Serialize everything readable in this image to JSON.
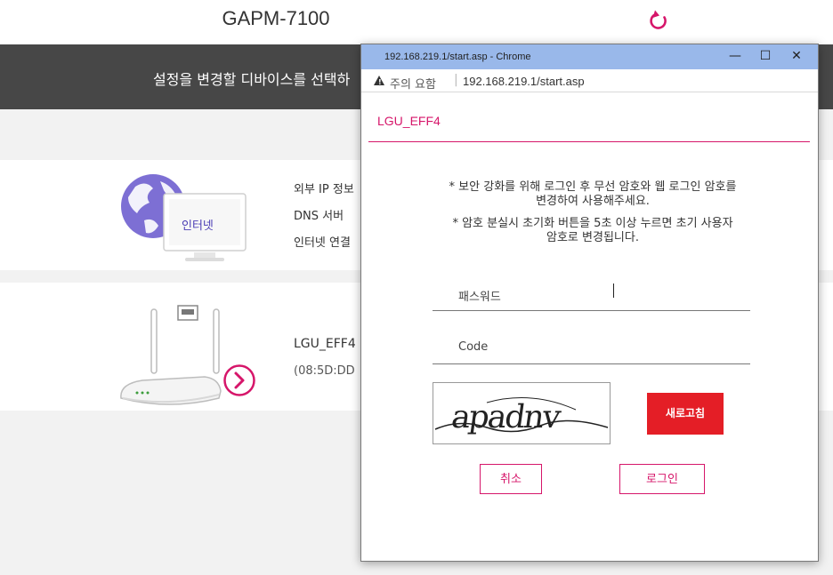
{
  "app": {
    "title": "GAPM-7100"
  },
  "banner": {
    "text": "설정을 변경할 디바이스를 선택하"
  },
  "internet_card": {
    "icon_label": "인터넷",
    "rows": [
      "외부 IP 정보",
      "DNS 서버",
      "인터넷 연결"
    ]
  },
  "device_card": {
    "name": "LGU_EFF4",
    "mac": "(08:5D:DD"
  },
  "popup": {
    "window_title": "192.168.219.1/start.asp - Chrome",
    "controls": {
      "minimize": "—",
      "maximize": "☐",
      "close": "✕"
    },
    "security_warning": "주의 요함",
    "address": "192.168.219.1/start.asp",
    "ssid": "LGU_EFF4",
    "notice_lines": [
      "* 보안 강화를 위해 로그인 후 무선 암호와 웹 로그인 암호를",
      "변경하여 사용해주세요.",
      "* 암호 분실시 초기화 버튼을 5초 이상 누르면 초기 사용자",
      "암호로 변경됩니다."
    ],
    "password_label": "패스워드",
    "code_label": "Code",
    "captcha_text": "apadnv",
    "refresh_label": "새로고침",
    "cancel_label": "취소",
    "login_label": "로그인"
  },
  "colors": {
    "accent": "#d6166a",
    "refresh_button": "#e41e26",
    "banner_bg": "#474747",
    "titlebar": "#99b8ea",
    "globe": "#7d6fd4"
  }
}
